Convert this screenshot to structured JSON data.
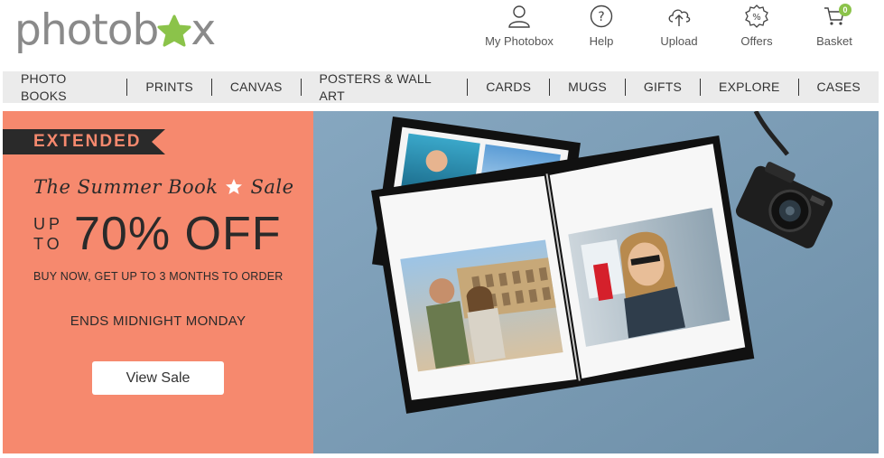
{
  "brand": {
    "logo_text_main": "photob",
    "logo_text_tail": "x",
    "star_color": "#8bc34a",
    "text_color": "#8a8a8a"
  },
  "header_nav": [
    {
      "label": "My Photobox",
      "icon": "user-icon"
    },
    {
      "label": "Help",
      "icon": "help-icon"
    },
    {
      "label": "Upload",
      "icon": "upload-cloud-icon"
    },
    {
      "label": "Offers",
      "icon": "offers-badge-icon"
    },
    {
      "label": "Basket",
      "icon": "cart-icon"
    }
  ],
  "basket_count": "0",
  "menu": [
    "PHOTO BOOKS",
    "PRINTS",
    "CANVAS",
    "POSTERS & WALL ART",
    "CARDS",
    "MUGS",
    "GIFTS",
    "EXPLORE",
    "CASES"
  ],
  "promo": {
    "ribbon": "EXTENDED",
    "headline_left": "The Summer Book",
    "headline_right": "Sale",
    "up": "UP",
    "to": "TO",
    "discount": "70% OFF",
    "subline": "BUY NOW, GET UP TO 3 MONTHS TO ORDER",
    "ends": "ENDS MIDNIGHT MONDAY",
    "cta": "View Sale",
    "bg_color": "#f6896e",
    "ribbon_color": "#2a2a2a"
  },
  "hero_image": {
    "bg_color": "#7a9bb5"
  }
}
